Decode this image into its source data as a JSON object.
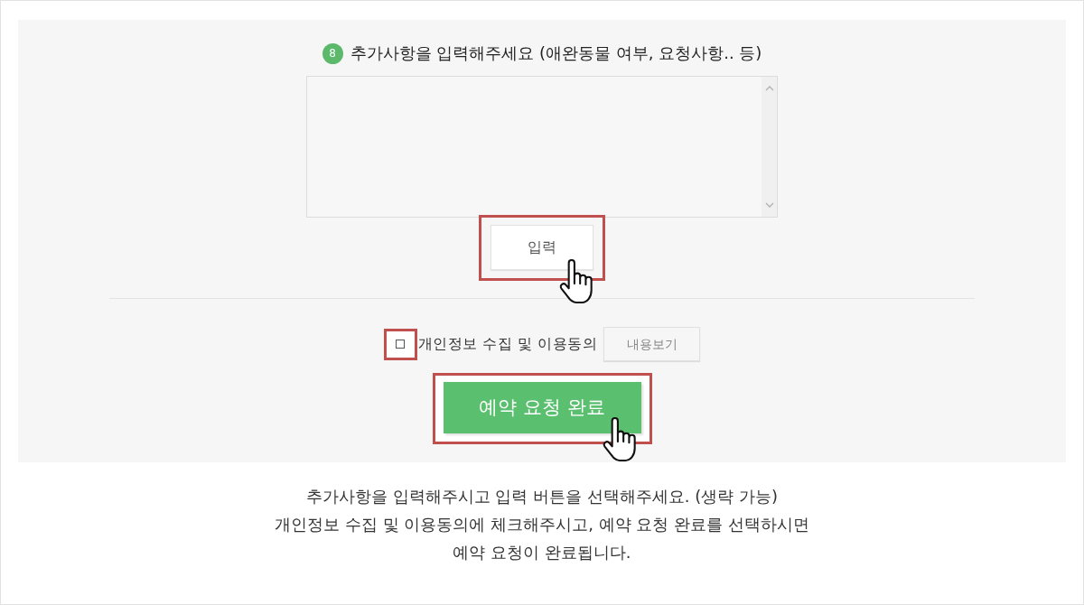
{
  "step": {
    "number": "8",
    "title": "추가사항을 입력해주세요 (애완동물 여부, 요청사항.. 등)"
  },
  "input_button": {
    "label": "입력",
    "highlighted": true,
    "cursor": true
  },
  "consent": {
    "checked": false,
    "highlighted": true,
    "label": "개인정보 수집 및 이용동의",
    "view_button": "내용보기"
  },
  "submit_button": {
    "label": "예약 요청 완료",
    "highlighted": true,
    "cursor": true
  },
  "instructions": [
    "추가사항을 입력해주시고 입력 버튼을 선택해주세요. (생략 가능)",
    "개인정보 수집 및 이용동의에 체크해주시고, 예약 요청 완료를 선택하시면",
    "예약 요청이 완료됩니다."
  ]
}
